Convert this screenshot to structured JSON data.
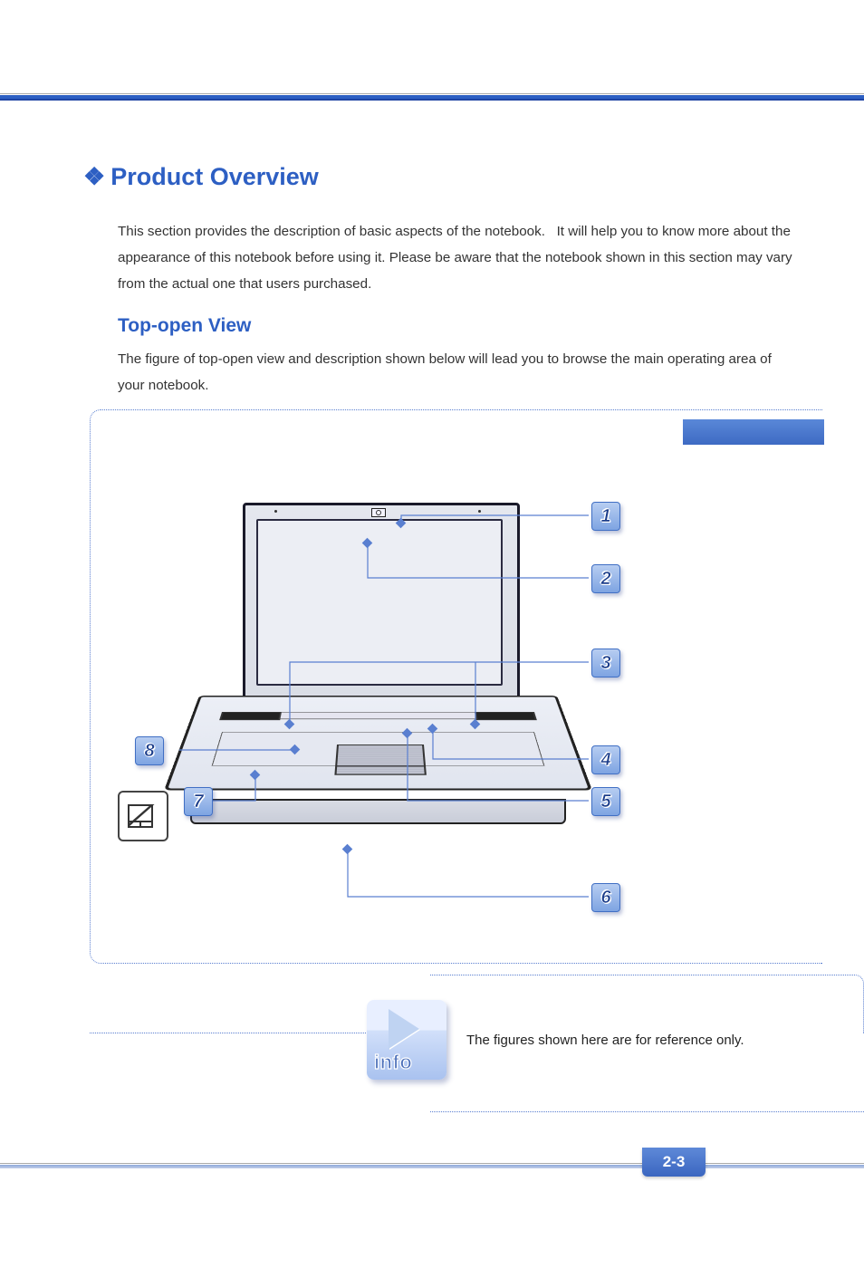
{
  "heading": "Product Overview",
  "intro": "This section provides the description of basic aspects of the notebook.   It will help you to know more about the appearance of this notebook before using it. Please be aware that the notebook shown in this section may vary from the actual one that users purchased.",
  "subheading": "Top-open View",
  "subintro": "The figure of top-open view and description shown below will lead you to browse the main operating area of your notebook.",
  "callouts": {
    "n1": "1",
    "n2": "2",
    "n3": "3",
    "n4": "4",
    "n5": "5",
    "n6": "6",
    "n7": "7",
    "n8": "8"
  },
  "info_label": "info",
  "info_caption": "The figures shown here are for reference only.",
  "page_number": "2-3"
}
